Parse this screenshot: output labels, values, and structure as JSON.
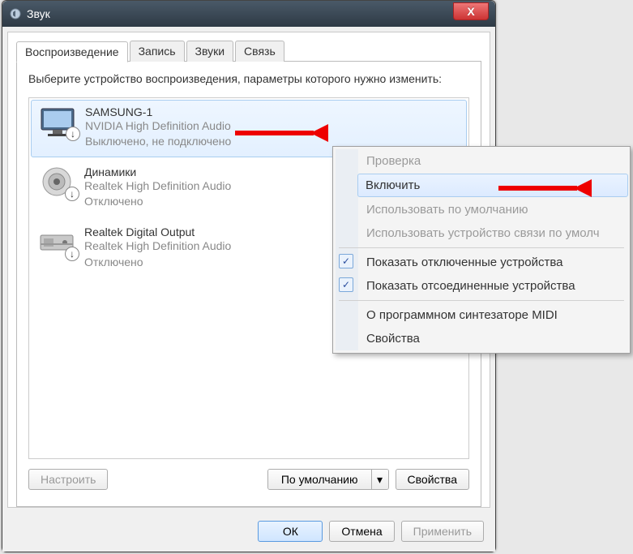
{
  "window": {
    "title": "Звук"
  },
  "tabs": {
    "playback": "Воспроизведение",
    "recording": "Запись",
    "sounds": "Звуки",
    "comm": "Связь"
  },
  "instruction": "Выберите устройство воспроизведения, параметры которого нужно изменить:",
  "devices": [
    {
      "name": "SAMSUNG-1",
      "driver": "NVIDIA High Definition Audio",
      "status": "Выключено, не подключено"
    },
    {
      "name": "Динамики",
      "driver": "Realtek High Definition Audio",
      "status": "Отключено"
    },
    {
      "name": "Realtek Digital Output",
      "driver": "Realtek High Definition Audio",
      "status": "Отключено"
    }
  ],
  "buttons": {
    "configure": "Настроить",
    "default": "По умолчанию",
    "properties": "Свойства",
    "ok": "ОК",
    "cancel": "Отмена",
    "apply": "Применить"
  },
  "menu": {
    "test": "Проверка",
    "enable": "Включить",
    "default": "Использовать по умолчанию",
    "comm_default": "Использовать устройство связи по умолч",
    "show_disabled": "Показать отключенные устройства",
    "show_disconnected": "Показать отсоединенные устройства",
    "midi": "О программном синтезаторе MIDI",
    "props": "Свойства"
  },
  "icons": {
    "close": "X",
    "dropdown": "▾",
    "check": "✓",
    "down_arrow": "↓"
  }
}
